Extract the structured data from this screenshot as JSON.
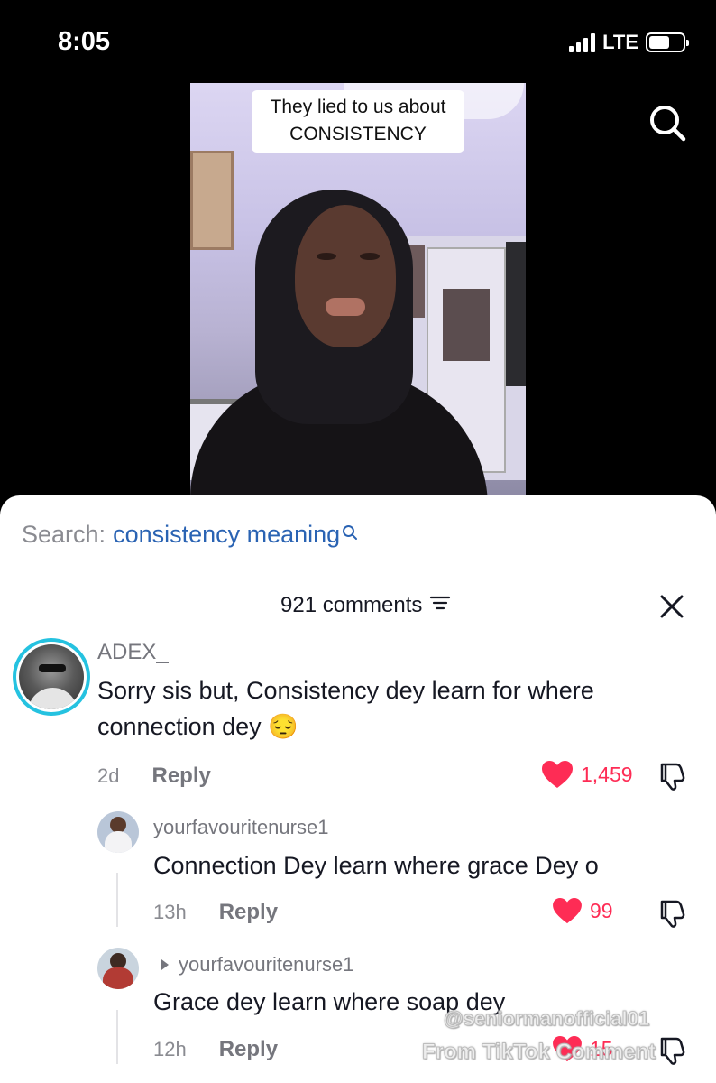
{
  "status_bar": {
    "time": "8:05",
    "network": "LTE"
  },
  "video": {
    "caption_line1": "They lied to us about",
    "caption_line2": "CONSISTENCY"
  },
  "search": {
    "prefix": "Search:",
    "term": "consistency meaning"
  },
  "comments_header": {
    "count": "921 comments"
  },
  "comments": [
    {
      "username": "ADEX_",
      "text_line1": "Sorry sis but, Consistency dey learn for where",
      "text_line2": "connection dey 😔",
      "time": "2d",
      "reply_label": "Reply",
      "likes": "1,459"
    },
    {
      "username": "yourfavouritenurse1",
      "text": "Connection Dey learn where grace Dey o",
      "time": "13h",
      "reply_label": "Reply",
      "likes": "99"
    },
    {
      "username": "yourfavouritenurse1",
      "text": "Grace dey learn where soap dey",
      "time": "12h",
      "reply_label": "Reply",
      "likes": "15"
    }
  ],
  "watermark": {
    "line1": "@seniormanofficial01",
    "line2": "From TikTok Comment"
  },
  "colors": {
    "accent_like": "#fe2c55",
    "search_term": "#2a63b3",
    "avatar_ring": "#25c2e0"
  },
  "icons": [
    "search-icon",
    "close-icon",
    "sort-icon",
    "heart-icon",
    "dislike-icon",
    "reply-arrow-icon"
  ]
}
